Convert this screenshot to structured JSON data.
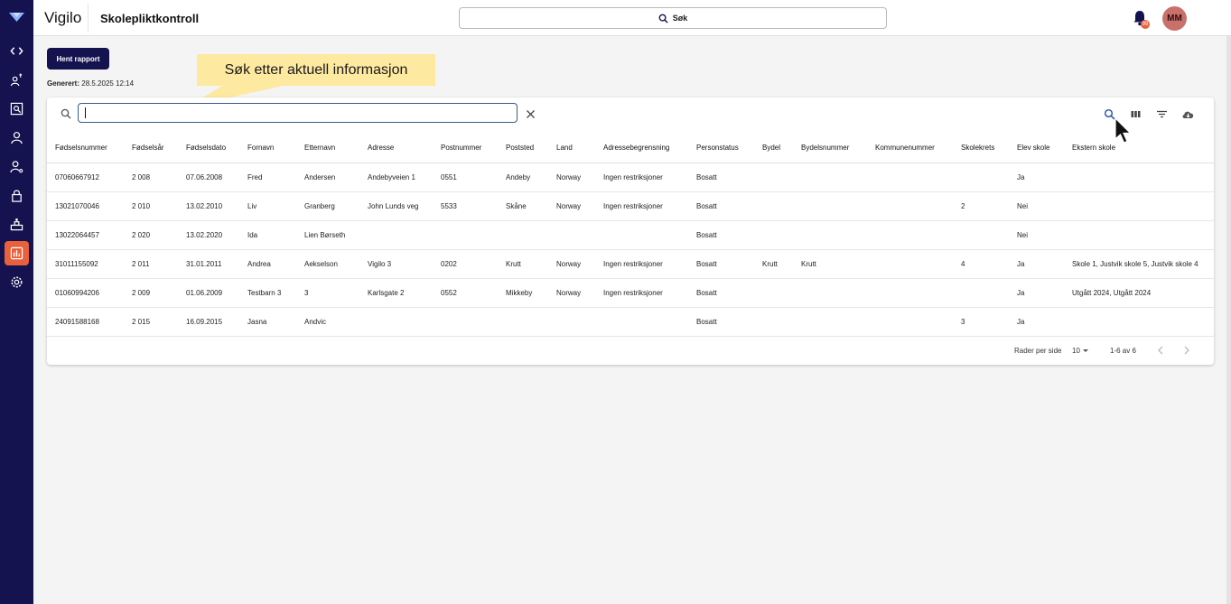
{
  "app": {
    "brand": "Vigilo",
    "title": "Skolepliktkontroll"
  },
  "header": {
    "search_label": "Søk",
    "notification_count": "99",
    "avatar_initials": "MM"
  },
  "sidebar": {
    "items": [
      {
        "icon": "code-icon"
      },
      {
        "icon": "people-chart-icon"
      },
      {
        "icon": "search-document-icon"
      },
      {
        "icon": "person-icon"
      },
      {
        "icon": "person-settings-icon"
      },
      {
        "icon": "lock-icon"
      },
      {
        "icon": "podium-icon"
      },
      {
        "icon": "bar-chart-icon",
        "active": true
      },
      {
        "icon": "gear-icon"
      }
    ],
    "active_color": "#e8613c",
    "background_color": "#14124f"
  },
  "report": {
    "button_label": "Hent rapport",
    "generated_label": "Generert:",
    "generated_value": "28.5.2025 12:14"
  },
  "callout": {
    "text": "Søk etter aktuell informasjon"
  },
  "table": {
    "search_value": "",
    "columns": [
      "Fødselsnummer",
      "Fødselsår",
      "Fødselsdato",
      "Fornavn",
      "Etternavn",
      "Adresse",
      "Postnummer",
      "Poststed",
      "Land",
      "Adressebegrensning",
      "Personstatus",
      "Bydel",
      "Bydelsnummer",
      "Kommunenummer",
      "Skolekrets",
      "Elev skole",
      "Ekstern skole"
    ],
    "rows": [
      [
        "07060667912",
        "2 008",
        "07.06.2008",
        "Fred",
        "Andersen",
        "Andebyveien 1",
        "0551",
        "Andeby",
        "Norway",
        "Ingen restriksjoner",
        "Bosatt",
        "",
        "",
        "",
        "",
        "Ja",
        ""
      ],
      [
        "13021070046",
        "2 010",
        "13.02.2010",
        "Liv",
        "Granberg",
        "John Lunds veg",
        "5533",
        "Skåne",
        "Norway",
        "Ingen restriksjoner",
        "Bosatt",
        "",
        "",
        "",
        "2",
        "Nei",
        ""
      ],
      [
        "13022064457",
        "2 020",
        "13.02.2020",
        "Ida",
        "Lien Børseth",
        "",
        "",
        "",
        "",
        "",
        "Bosatt",
        "",
        "",
        "",
        "",
        "Nei",
        ""
      ],
      [
        "31011155092",
        "2 011",
        "31.01.2011",
        "Andrea",
        "Aekselson",
        "Vigilo 3",
        "0202",
        "Krutt",
        "Norway",
        "Ingen restriksjoner",
        "Bosatt",
        "Krutt",
        "Krutt",
        "",
        "4",
        "Ja",
        "Skole 1, Justvik skole 5, Justvik skole 4"
      ],
      [
        "01060994206",
        "2 009",
        "01.06.2009",
        "Testbarn 3",
        "3",
        "Karlsgate 2",
        "0552",
        "Mikkeby",
        "Norway",
        "Ingen restriksjoner",
        "Bosatt",
        "",
        "",
        "",
        "",
        "Ja",
        "Utgått 2024, Utgått 2024"
      ],
      [
        "24091588168",
        "2 015",
        "16.09.2015",
        "Jasna",
        "Andvic",
        "",
        "",
        "",
        "",
        "",
        "Bosatt",
        "",
        "",
        "",
        "3",
        "Ja",
        ""
      ]
    ],
    "rows_per_page_label": "Rader per side",
    "rows_per_page_value": "10",
    "range_label": "1-6 av 6"
  }
}
